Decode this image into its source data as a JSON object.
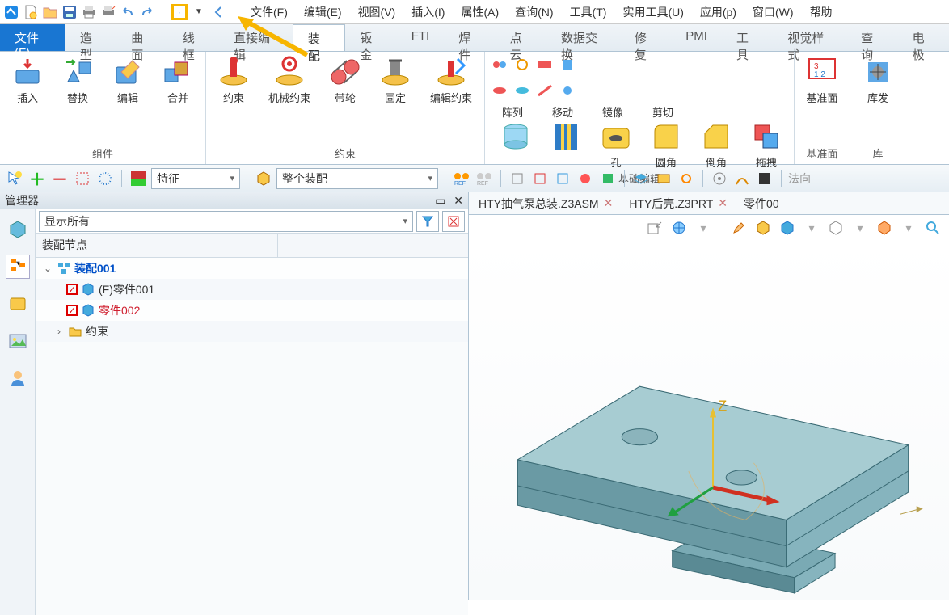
{
  "menubar": {
    "items": [
      "文件(F)",
      "编辑(E)",
      "视图(V)",
      "插入(I)",
      "属性(A)",
      "查询(N)",
      "工具(T)",
      "实用工具(U)",
      "应用(p)",
      "窗口(W)",
      "帮助"
    ]
  },
  "ribbon_tabs": {
    "file": "文件(F)",
    "items": [
      "造型",
      "曲面",
      "线框",
      "直接编辑",
      "装配",
      "钣金",
      "FTI",
      "焊件",
      "点云",
      "数据交换",
      "修复",
      "PMI",
      "工具",
      "视觉样式",
      "查询",
      "电极"
    ]
  },
  "ribbon": {
    "group1": {
      "label": "组件",
      "items": [
        "插入",
        "替换",
        "编辑",
        "合并"
      ]
    },
    "group2": {
      "label": "约束",
      "items": [
        "约束",
        "机械约束",
        "带轮",
        "固定",
        "编辑约束"
      ]
    },
    "group3": {
      "label": "基础编辑",
      "items": [
        "阵列",
        "移动",
        "镜像",
        "剪切",
        "孔",
        "圆角",
        "倒角",
        "拖拽"
      ]
    },
    "group4": {
      "label": "基准面",
      "items": [
        "基准面"
      ]
    },
    "group5": {
      "label": "库",
      "items": [
        "库发"
      ]
    }
  },
  "toolbar2": {
    "combo1": "特征",
    "combo2": "整个装配",
    "endlabel": "法向"
  },
  "manager": {
    "title": "管理器",
    "filter": "显示所有",
    "tree_header": "装配节点",
    "nodes": {
      "root": "装配001",
      "part1": "(F)零件001",
      "part2": "零件002",
      "constraints": "约束"
    }
  },
  "viewport": {
    "tabs": [
      {
        "label": "HTY抽气泵总装.Z3ASM",
        "close": "✕"
      },
      {
        "label": "HTY后壳.Z3PRT",
        "close": "✕"
      },
      {
        "label": "零件00"
      }
    ],
    "axis_z": "Z"
  }
}
